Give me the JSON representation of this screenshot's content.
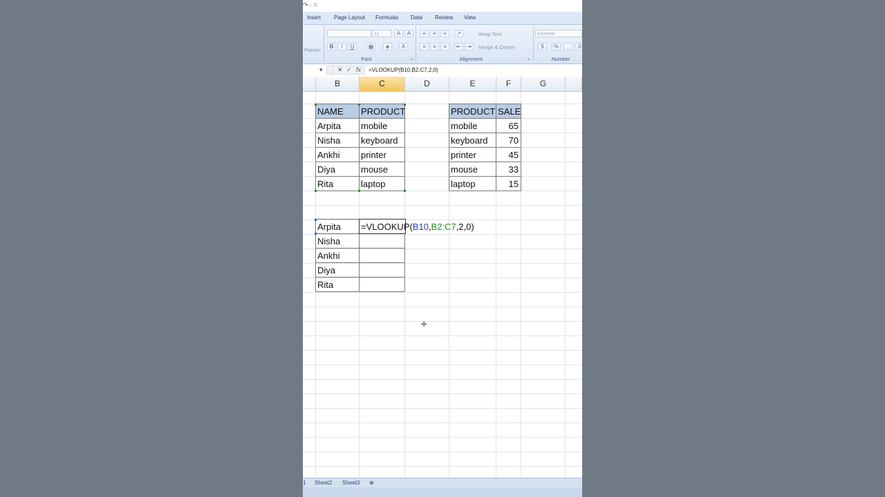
{
  "qat": {
    "text": "↷ · ="
  },
  "tabs": [
    "Insert",
    "Page Layout",
    "Formulas",
    "Data",
    "Review",
    "View"
  ],
  "ribbon": {
    "painter_label": "Painter",
    "font_size": "11",
    "wrap_text": "Wrap Text",
    "merge_center": "Merge & Center",
    "number_format": "General",
    "font_group": "Font",
    "alignment_group": "Alignment",
    "number_group": "Number",
    "bold": "B",
    "italic": "I",
    "underline": "U",
    "percent": "%"
  },
  "formula_bar": {
    "formula": "=VLOOKUP(B10,B2:C7,2,0)",
    "fx": "fx"
  },
  "columns": [
    "B",
    "C",
    "D",
    "E",
    "F",
    "G"
  ],
  "active_column": "C",
  "table1": {
    "headers": [
      "NAME",
      "PRODUCT"
    ],
    "rows": [
      [
        "Arpita",
        "mobile"
      ],
      [
        "Nisha",
        "keyboard"
      ],
      [
        "Ankhi",
        "printer"
      ],
      [
        "Diya",
        "mouse"
      ],
      [
        "Rita",
        "laptop"
      ]
    ]
  },
  "table2": {
    "headers": [
      "PRODUCT",
      "SALE"
    ],
    "rows": [
      [
        "mobile",
        "65"
      ],
      [
        "keyboard",
        "70"
      ],
      [
        "printer",
        "45"
      ],
      [
        "mouse",
        "33"
      ],
      [
        "laptop",
        "15"
      ]
    ]
  },
  "lookup_names": [
    "Arpita",
    "Nisha",
    "Ankhi",
    "Diya",
    "Rita"
  ],
  "editing_formula": {
    "eq": "=",
    "fn": "VLOOKUP(",
    "arg1": "B10",
    "comma1": ",",
    "arg2": "B2:C7",
    "rest": ",2,0)"
  },
  "sheets": {
    "partial": "1",
    "sheet2": "Sheet2",
    "sheet3": "Sheet3"
  },
  "colors": {
    "header_fill": "#b8cce4",
    "active_col": "#f3c55e",
    "ref_blue": "#2d3fb8",
    "ref_green": "#2a8a2a"
  }
}
